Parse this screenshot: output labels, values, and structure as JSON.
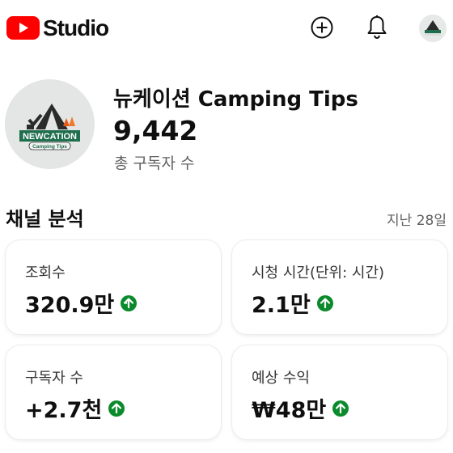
{
  "app": {
    "logo_text": "Studio"
  },
  "channel": {
    "name": "뉴케이션 Camping Tips",
    "subscriber_count": "9,442",
    "subscriber_label": "총 구독자 수",
    "avatar_text_main": "NEWCATION",
    "avatar_text_sub": "Camping Tips"
  },
  "analytics": {
    "title": "채널 분석",
    "period": "지난 28일",
    "cards": [
      {
        "label": "조회수",
        "value": "320.9만"
      },
      {
        "label": "시청 시간(단위: 시간)",
        "value": "2.1만"
      },
      {
        "label": "구독자 수",
        "value": "+2.7천"
      },
      {
        "label": "예상 수익",
        "value": "₩48만"
      }
    ]
  },
  "colors": {
    "brand_red": "#ff0000",
    "trend_up_green": "#0b8a2c",
    "text_secondary": "#606060"
  },
  "icons": {
    "create": "add-circle-icon",
    "notifications": "bell-icon",
    "trend": "arrow-up-circle-icon"
  }
}
